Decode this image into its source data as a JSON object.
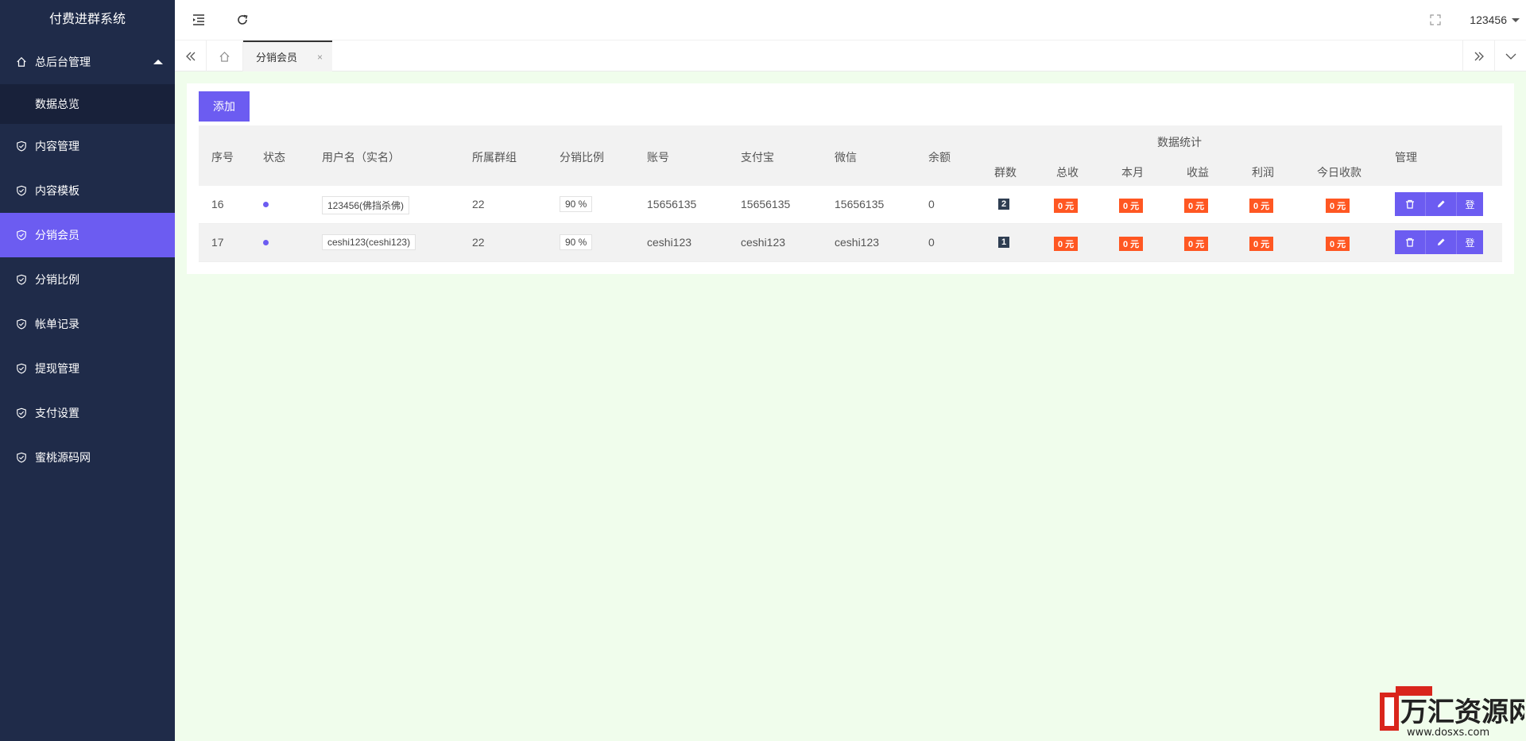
{
  "app": {
    "title": "付费进群系统"
  },
  "sidebar": {
    "group": {
      "label": "总后台管理",
      "icon": "home-icon"
    },
    "sub_items": [
      {
        "label": "数据总览"
      }
    ],
    "items": [
      {
        "label": "内容管理",
        "icon": "shield-check-icon"
      },
      {
        "label": "内容模板",
        "icon": "shield-check-icon"
      },
      {
        "label": "分销会员",
        "icon": "shield-check-icon",
        "active": true
      },
      {
        "label": "分销比例",
        "icon": "shield-check-icon"
      },
      {
        "label": "帐单记录",
        "icon": "shield-check-icon"
      },
      {
        "label": "提现管理",
        "icon": "shield-check-icon"
      },
      {
        "label": "支付设置",
        "icon": "shield-check-icon"
      },
      {
        "label": "蜜桃源码网",
        "icon": "shield-check-icon"
      }
    ]
  },
  "header": {
    "user": "123456"
  },
  "tabs": [
    {
      "label": "分销会员",
      "close": "×"
    }
  ],
  "toolbar": {
    "add_label": "添加"
  },
  "table": {
    "columns": {
      "seq": "序号",
      "status": "状态",
      "username": "用户名（实名）",
      "group": "所属群组",
      "ratio": "分销比例",
      "account": "账号",
      "alipay": "支付宝",
      "wechat": "微信",
      "balance": "余额",
      "stats": "数据统计",
      "groups": "群数",
      "total": "总收",
      "month": "本月",
      "income": "收益",
      "profit": "利润",
      "today": "今日收款",
      "manage": "管理"
    },
    "rows": [
      {
        "seq": "16",
        "username": "123456(佛挡杀佛)",
        "group": "22",
        "ratio": "90 %",
        "account": "15656135",
        "alipay": "15656135",
        "wechat": "15656135",
        "balance": "0",
        "groups": "2",
        "total": "0 元",
        "month": "0 元",
        "income": "0 元",
        "profit": "0 元",
        "today": "0 元"
      },
      {
        "seq": "17",
        "username": "ceshi123(ceshi123)",
        "group": "22",
        "ratio": "90 %",
        "account": "ceshi123",
        "alipay": "ceshi123",
        "wechat": "ceshi123",
        "balance": "0",
        "groups": "1",
        "total": "0 元",
        "month": "0 元",
        "income": "0 元",
        "profit": "0 元",
        "today": "0 元"
      }
    ],
    "actions": {
      "delete_icon": "trash-icon",
      "edit_icon": "pencil-icon",
      "login_label": "登"
    }
  },
  "watermark": {
    "brand": "万汇资源网",
    "url": "www.dosxs.com"
  },
  "colors": {
    "sidebar": "#1f2b49",
    "accent": "#6c5cf1",
    "badge_red": "#ff5722",
    "badge_dark": "#2f3e52",
    "page_bg": "#f0fdec"
  }
}
